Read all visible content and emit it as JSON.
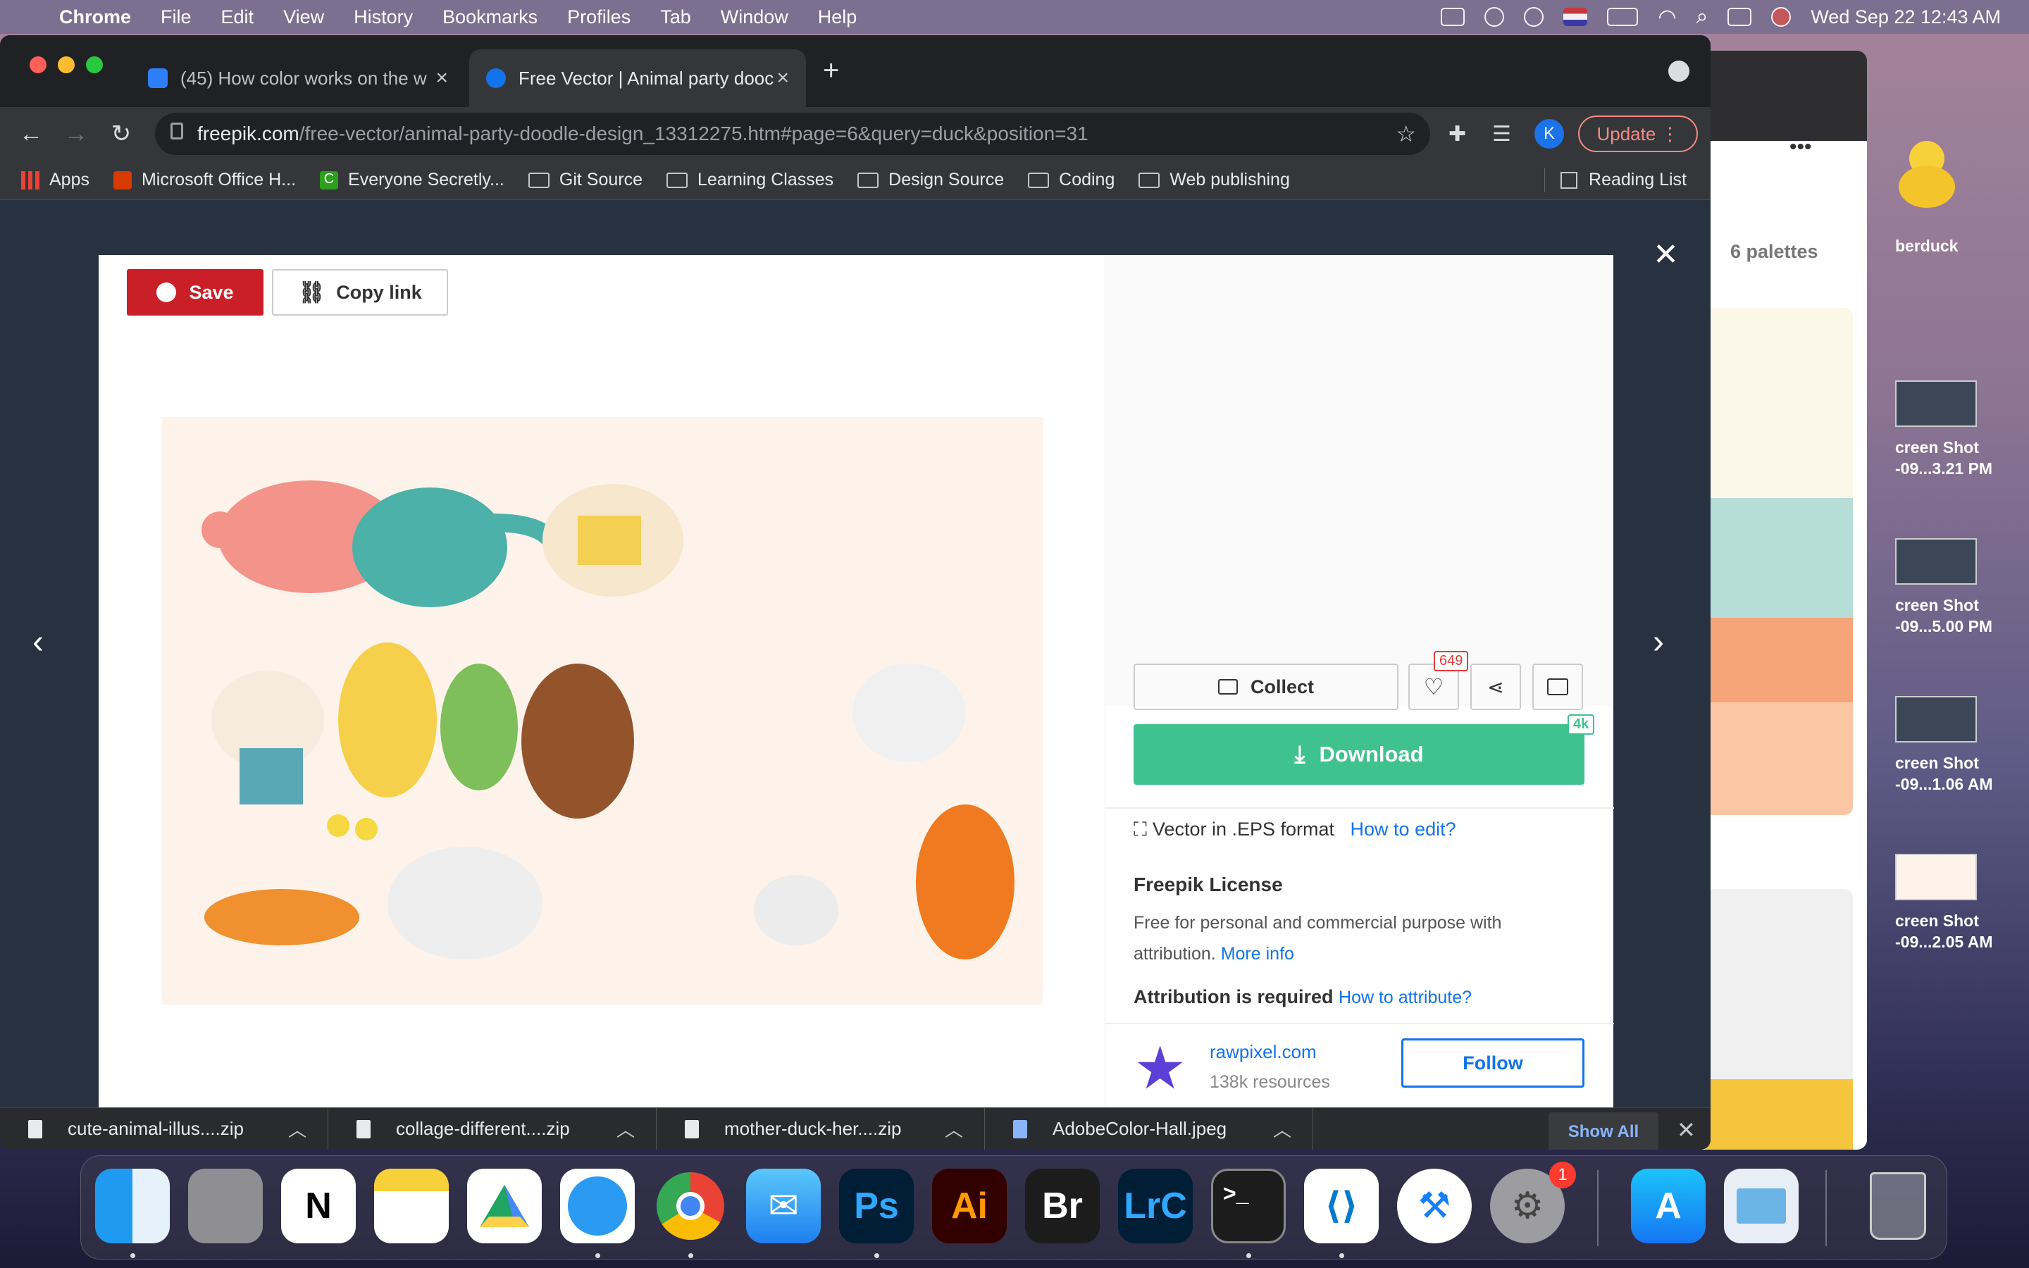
{
  "menubar": {
    "app": "Chrome",
    "items": [
      "File",
      "Edit",
      "View",
      "History",
      "Bookmarks",
      "Profiles",
      "Tab",
      "Window",
      "Help"
    ],
    "clock": "Wed Sep 22  12:43 AM"
  },
  "tabs": [
    {
      "title": "(45) How color works on the w",
      "active": false
    },
    {
      "title": "Free Vector | Animal party dooc",
      "active": true
    }
  ],
  "omnibox": {
    "host": "freepik.com",
    "path": "/free-vector/animal-party-doodle-design_13312275.htm#page=6&query=duck&position=31"
  },
  "profile_initial": "K",
  "update_label": "Update",
  "bookmarks": {
    "items": [
      "Apps",
      "Microsoft Office H...",
      "Everyone Secretly...",
      "Git Source",
      "Learning Classes",
      "Design Source",
      "Coding",
      "Web publishing"
    ],
    "reading_list": "Reading List"
  },
  "modal": {
    "save": "Save",
    "copy_link": "Copy link",
    "collect": "Collect",
    "likes": "649",
    "download": "Download",
    "badge": "4k",
    "format": "Vector in .EPS format",
    "how_to_edit": "How to edit?",
    "license_title": "Freepik License",
    "license_text": "Free for personal and commercial purpose with",
    "license_text2": "attribution.",
    "more_info": "More info",
    "attribution": "Attribution is required",
    "how_to_attribute": "How to attribute?",
    "author": "rawpixel.com",
    "resources": "138k resources",
    "follow": "Follow"
  },
  "background_window": {
    "palettes": "6 palettes",
    "swatches": [
      "#fbf8ea",
      "#b6ddd7",
      "#f6a47a",
      "#fcc6a5",
      "#f4c53d"
    ]
  },
  "downloads": [
    "cute-animal-illus....zip",
    "collage-different....zip",
    "mother-duck-her....zip",
    "AdobeColor-Hall.jpeg"
  ],
  "show_all": "Show All",
  "desktop": {
    "rubberduck": "berduck",
    "files": [
      {
        "line1": "creen Shot",
        "line2": "-09...3.21 PM"
      },
      {
        "line1": "creen Shot",
        "line2": "-09...5.00 PM"
      },
      {
        "line1": "creen Shot",
        "line2": "-09...1.06 AM"
      },
      {
        "line1": "creen Shot",
        "line2": "-09...2.05 AM"
      }
    ]
  },
  "dock": {
    "apps": [
      "Finder",
      "Launchpad",
      "Notion",
      "Notes",
      "Google Drive",
      "Safari",
      "Chrome",
      "Mail",
      "Photoshop",
      "Illustrator",
      "Bridge",
      "Lightroom Classic",
      "Terminal",
      "VS Code",
      "Xcode",
      "System Preferences",
      "App Store",
      "Preview",
      "Trash"
    ],
    "labels": {
      "ps": "Ps",
      "ai": "Ai",
      "br": "Br",
      "lrc": "LrC",
      "notion": "N"
    },
    "sysprefs_badge": "1"
  }
}
